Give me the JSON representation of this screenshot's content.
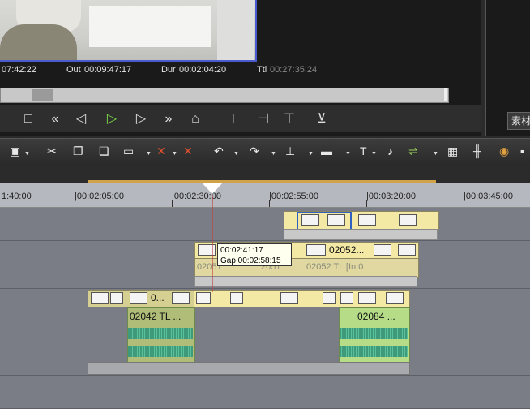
{
  "preview": {
    "current_time": "07:42:22",
    "out_label": "Out",
    "out_value": "00:09:47:17",
    "dur_label": "Dur",
    "dur_value": "00:02:04:20",
    "ttl_label": "Ttl",
    "ttl_value": "00:27:35:24"
  },
  "side_panel": {
    "tab_label": "素材"
  },
  "ruler": {
    "labels": [
      "1:40:00",
      "|00:02:05:00",
      "|00:02:30:00",
      "|00:02:55:00",
      "|00:03:20:00",
      "|00:03:45:00"
    ]
  },
  "tooltip": {
    "line1": "00:02:41:17",
    "line2": "Gap  00:02:58:15"
  },
  "clips": {
    "track2_label": "02052...",
    "track2_ghost1": "02051",
    "track2_ghost2": "2051",
    "track2_ghost3": "02052   TL [In:0",
    "track3_label_a": "0...",
    "audio_label_a": "02042   TL ...",
    "audio_label_b": "02084 ..."
  },
  "colors": {
    "clip_yellow": "#f3e8a4",
    "clip_green": "#b6dc88",
    "playhead": "#48c2c0",
    "ruler_bg": "#b5b8be",
    "selection": "#3060c0"
  }
}
